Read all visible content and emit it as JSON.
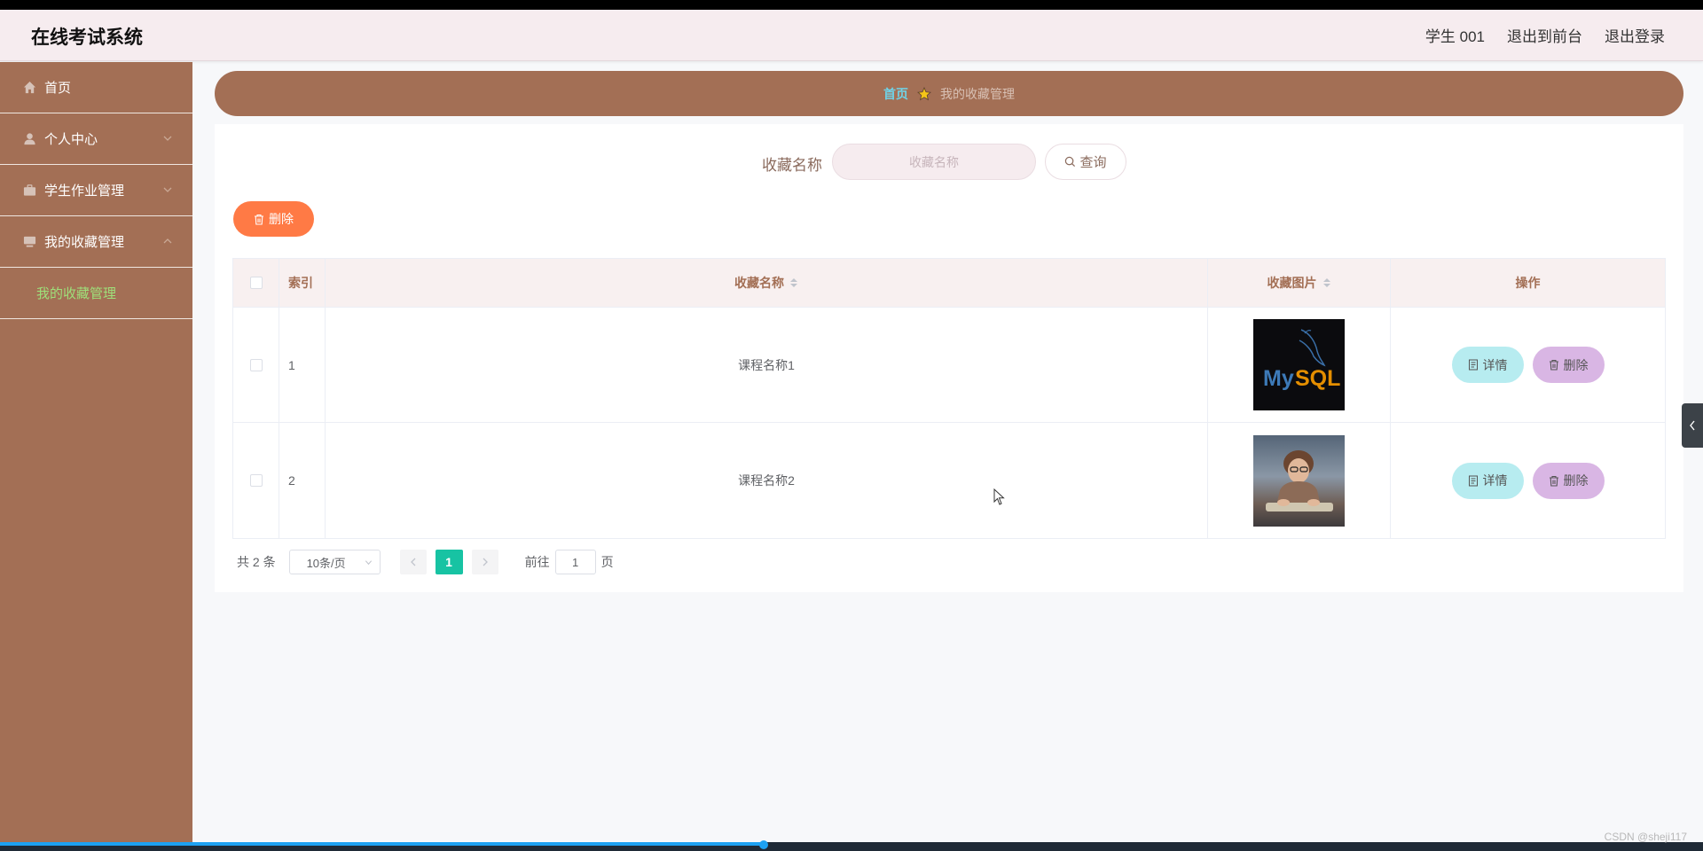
{
  "header": {
    "title": "在线考试系统",
    "user": "学生 001",
    "to_front": "退出到前台",
    "logout": "退出登录"
  },
  "sidebar": {
    "items": [
      {
        "label": "首页",
        "icon": "home-icon",
        "has_chevron": false
      },
      {
        "label": "个人中心",
        "icon": "user-icon",
        "has_chevron": true
      },
      {
        "label": "学生作业管理",
        "icon": "briefcase-icon",
        "has_chevron": true
      },
      {
        "label": "我的收藏管理",
        "icon": "monitor-icon",
        "has_chevron": true,
        "expanded": true
      }
    ],
    "subitem": "我的收藏管理",
    "subitem_color": "#9ee07a"
  },
  "breadcrumb": {
    "home": "首页",
    "current": "我的收藏管理"
  },
  "search": {
    "label": "收藏名称",
    "placeholder": "收藏名称",
    "button": "查询"
  },
  "toolbar": {
    "delete_label": "删除"
  },
  "table": {
    "columns": [
      "索引",
      "收藏名称",
      "收藏图片",
      "操作"
    ],
    "rows": [
      {
        "index": "1",
        "name": "课程名称1",
        "image": "MySQL",
        "detail": "详情",
        "delete": "删除"
      },
      {
        "index": "2",
        "name": "课程名称2",
        "image": "child-at-keyboard-photo",
        "detail": "详情",
        "delete": "删除"
      }
    ]
  },
  "pagination": {
    "total": "共 2 条",
    "page_size": "10条/页",
    "current_page": "1",
    "goto_label": "前往",
    "goto_value": "1",
    "page_unit": "页"
  },
  "watermark": "CSDN @sheji117",
  "colors": {
    "brand": "#a36f55",
    "header_bg": "#f6ecef",
    "primary_delete": "#ff7a45",
    "detail": "#b7ecf0",
    "row_delete": "#d9b6e4",
    "pager_active": "#17c3a3"
  }
}
